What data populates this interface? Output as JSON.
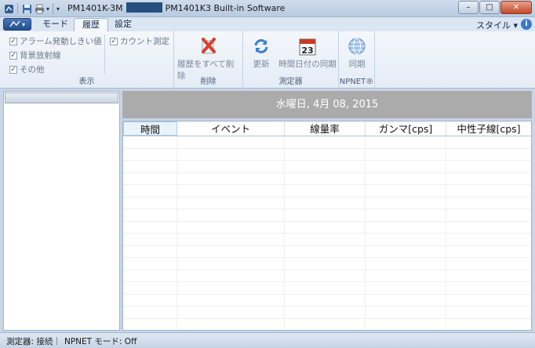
{
  "titlebar": {
    "device": "PM1401K-3M",
    "software": "PM1401K3 Built-in Software",
    "minimize": "–",
    "maximize": "□",
    "close": "✕"
  },
  "tabs": [
    {
      "label": "モード"
    },
    {
      "label": "履歴"
    },
    {
      "label": "設定"
    }
  ],
  "style_menu": "スタイル ▾",
  "help": "i",
  "ribbon": {
    "display_group": {
      "label": "表示",
      "items": [
        "アラーム発動しきい値",
        "背景放射線",
        "その他",
        "カウント測定"
      ]
    },
    "delete_group": {
      "label": "削除",
      "button": "履歴をすべて削除"
    },
    "instrument_group": {
      "label": "測定器",
      "refresh": "更新",
      "sync_time": "時間日付の同期",
      "calendar_day": "23"
    },
    "npnet_group": {
      "label": "NPNET®",
      "sync": "同期"
    }
  },
  "date_banner": "水曜日, 4月 08, 2015",
  "table": {
    "columns": [
      "時間",
      "イベント",
      "線量率",
      "ガンマ[cps]",
      "中性子線[cps]"
    ]
  },
  "status": {
    "instrument": "測定器: 接続",
    "npnet_mode": "NPNET モード: Off"
  },
  "colors": {
    "accent": "#25507f",
    "banner": "#ababab"
  }
}
